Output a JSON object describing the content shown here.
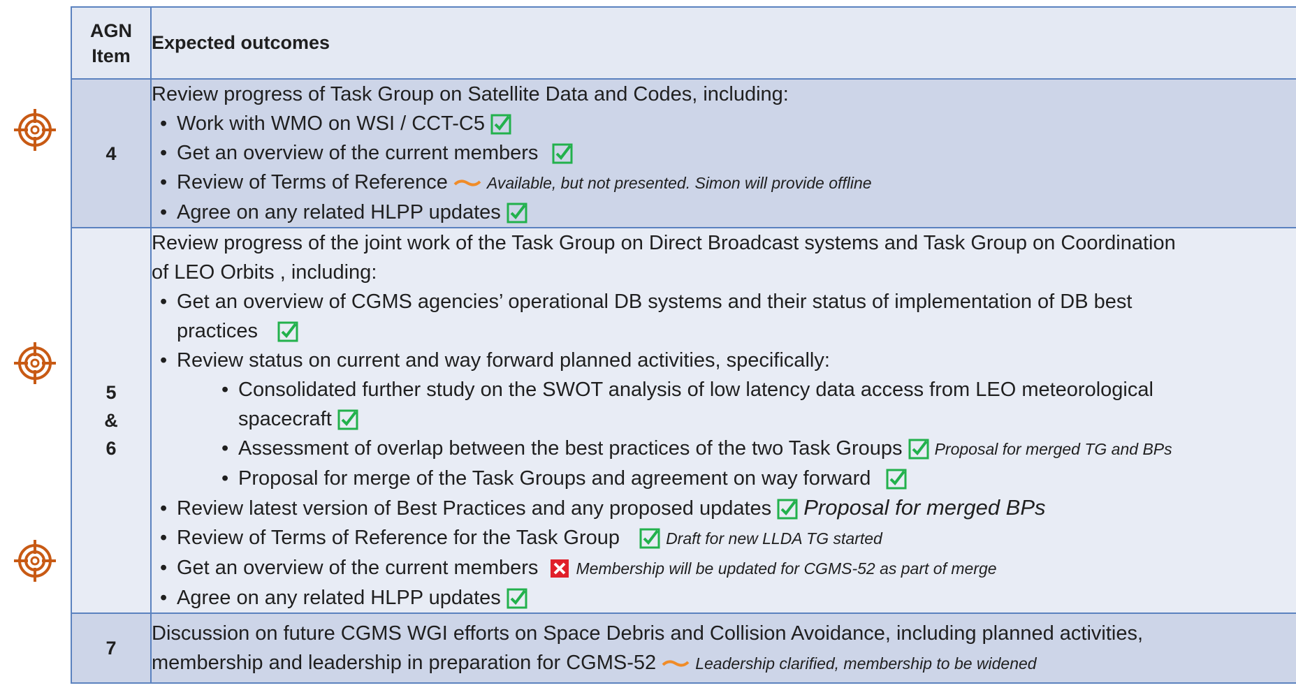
{
  "table": {
    "header": {
      "col1": "AGN Item",
      "col2": "Expected outcomes"
    },
    "rows": [
      {
        "agn": "4",
        "intro": "Review progress of Task Group on Satellite Data and Codes, including:",
        "items": [
          "Work with WMO on WSI / CCT-C5",
          "Get an overview of the current members",
          "Review of Terms of Reference",
          "Agree on any related HLPP updates"
        ],
        "notes": {
          "tor": "Available, but not presented. Simon will provide offline"
        }
      },
      {
        "agn_lines": [
          "5",
          "&",
          "6"
        ],
        "intro_lines": [
          "Review progress of the joint work of the Task Group on Direct Broadcast systems and Task Group on Coordination",
          "of LEO Orbits , including:"
        ],
        "item1_lines": [
          "Get an overview of CGMS agencies’ operational DB systems and their status of implementation of DB best",
          "practices"
        ],
        "item2": "Review status on current and way forward planned activities, specifically:",
        "sub1_lines": [
          "Consolidated further study on the SWOT analysis of low latency data access from LEO meteorological",
          "spacecraft"
        ],
        "sub2": "Assessment of overlap between the best practices of the two Task Groups",
        "sub2_note": "Proposal for merged TG and BPs",
        "sub3": "Proposal for merge of the Task Groups and agreement on way forward",
        "item3": "Review latest version of Best Practices and any proposed updates",
        "item3_note": "Proposal for merged BPs",
        "item4": "Review of Terms of Reference for the Task Group",
        "item4_note": "Draft for new LLDA TG started",
        "item5": "Get an overview of the current members",
        "item5_note": "Membership will be updated for CGMS-52 as part of merge",
        "item6": "Agree on any related HLPP updates"
      },
      {
        "agn": "7",
        "lines": [
          "Discussion on future CGMS WGI efforts on Space Debris and Collision Avoidance, including planned activities,",
          "membership and leadership in preparation for CGMS-52"
        ],
        "note": "Leadership clarified, membership to be widened"
      }
    ]
  },
  "bullet": "•",
  "colors": {
    "border": "#5b82bf",
    "check": "#22b14c",
    "cross": "#e0202a",
    "tilde": "#f08c28",
    "target": "#c85a14"
  },
  "icons": [
    "target-icon",
    "checkbox-checked-icon",
    "checkbox-cross-icon",
    "tilde-partial-icon"
  ]
}
